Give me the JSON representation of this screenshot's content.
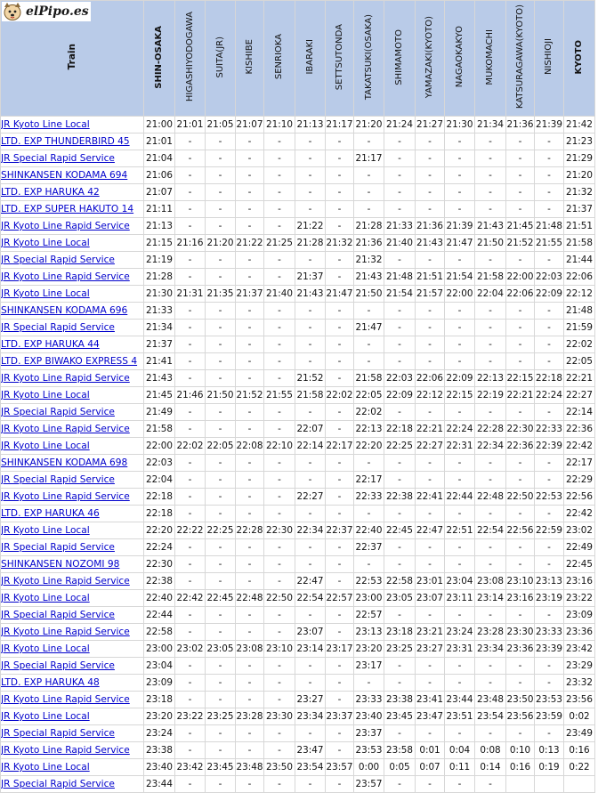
{
  "logo": {
    "text": "elPipo.es",
    "icon": "dog-face-icon"
  },
  "header": {
    "train_label": "Train",
    "stations": [
      "SHIN-OSAKA",
      "HIGASHIYODOGAWA",
      "SUITA(JR)",
      "KISHIBE",
      "SENRIOKA",
      "IBARAKI",
      "SETTSUTONDA",
      "TAKATSUKI(OSAKA)",
      "SHIMAMOTO",
      "YAMAZAKI(KYOTO)",
      "NAGAOKAKYO",
      "MUKOMACHI",
      "KATSURAGAWA(KYOTO)",
      "NISHIOJI",
      "KYOTO"
    ],
    "major_station_indices": [
      0,
      14
    ]
  },
  "rows": [
    {
      "train": "JR Kyoto Line Local",
      "times": [
        "21:00",
        "21:01",
        "21:05",
        "21:07",
        "21:10",
        "21:13",
        "21:17",
        "21:20",
        "21:24",
        "21:27",
        "21:30",
        "21:34",
        "21:36",
        "21:39",
        "21:42"
      ]
    },
    {
      "train": "LTD. EXP THUNDERBIRD 45",
      "times": [
        "21:01",
        "-",
        "-",
        "-",
        "-",
        "-",
        "-",
        "-",
        "-",
        "-",
        "-",
        "-",
        "-",
        "-",
        "21:23"
      ]
    },
    {
      "train": "JR Special Rapid Service",
      "times": [
        "21:04",
        "-",
        "-",
        "-",
        "-",
        "-",
        "-",
        "21:17",
        "-",
        "-",
        "-",
        "-",
        "-",
        "-",
        "21:29"
      ]
    },
    {
      "train": "SHINKANSEN KODAMA 694",
      "times": [
        "21:06",
        "-",
        "-",
        "-",
        "-",
        "-",
        "-",
        "-",
        "-",
        "-",
        "-",
        "-",
        "-",
        "-",
        "21:20"
      ]
    },
    {
      "train": "LTD. EXP HARUKA 42",
      "times": [
        "21:07",
        "-",
        "-",
        "-",
        "-",
        "-",
        "-",
        "-",
        "-",
        "-",
        "-",
        "-",
        "-",
        "-",
        "21:32"
      ]
    },
    {
      "train": "LTD. EXP SUPER HAKUTO 14",
      "times": [
        "21:11",
        "-",
        "-",
        "-",
        "-",
        "-",
        "-",
        "-",
        "-",
        "-",
        "-",
        "-",
        "-",
        "-",
        "21:37"
      ]
    },
    {
      "train": "JR Kyoto Line Rapid Service",
      "times": [
        "21:13",
        "-",
        "-",
        "-",
        "-",
        "21:22",
        "-",
        "21:28",
        "21:33",
        "21:36",
        "21:39",
        "21:43",
        "21:45",
        "21:48",
        "21:51"
      ]
    },
    {
      "train": "JR Kyoto Line Local",
      "times": [
        "21:15",
        "21:16",
        "21:20",
        "21:22",
        "21:25",
        "21:28",
        "21:32",
        "21:36",
        "21:40",
        "21:43",
        "21:47",
        "21:50",
        "21:52",
        "21:55",
        "21:58"
      ]
    },
    {
      "train": "JR Special Rapid Service",
      "times": [
        "21:19",
        "-",
        "-",
        "-",
        "-",
        "-",
        "-",
        "21:32",
        "-",
        "-",
        "-",
        "-",
        "-",
        "-",
        "21:44"
      ]
    },
    {
      "train": "JR Kyoto Line Rapid Service",
      "times": [
        "21:28",
        "-",
        "-",
        "-",
        "-",
        "21:37",
        "-",
        "21:43",
        "21:48",
        "21:51",
        "21:54",
        "21:58",
        "22:00",
        "22:03",
        "22:06"
      ]
    },
    {
      "train": "JR Kyoto Line Local",
      "times": [
        "21:30",
        "21:31",
        "21:35",
        "21:37",
        "21:40",
        "21:43",
        "21:47",
        "21:50",
        "21:54",
        "21:57",
        "22:00",
        "22:04",
        "22:06",
        "22:09",
        "22:12"
      ]
    },
    {
      "train": "SHINKANSEN KODAMA 696",
      "times": [
        "21:33",
        "-",
        "-",
        "-",
        "-",
        "-",
        "-",
        "-",
        "-",
        "-",
        "-",
        "-",
        "-",
        "-",
        "21:48"
      ]
    },
    {
      "train": "JR Special Rapid Service",
      "times": [
        "21:34",
        "-",
        "-",
        "-",
        "-",
        "-",
        "-",
        "21:47",
        "-",
        "-",
        "-",
        "-",
        "-",
        "-",
        "21:59"
      ]
    },
    {
      "train": "LTD. EXP HARUKA 44",
      "times": [
        "21:37",
        "-",
        "-",
        "-",
        "-",
        "-",
        "-",
        "-",
        "-",
        "-",
        "-",
        "-",
        "-",
        "-",
        "22:02"
      ]
    },
    {
      "train": "LTD. EXP BIWAKO EXPRESS 4",
      "times": [
        "21:41",
        "-",
        "-",
        "-",
        "-",
        "-",
        "-",
        "-",
        "-",
        "-",
        "-",
        "-",
        "-",
        "-",
        "22:05"
      ]
    },
    {
      "train": "JR Kyoto Line Rapid Service",
      "times": [
        "21:43",
        "-",
        "-",
        "-",
        "-",
        "21:52",
        "-",
        "21:58",
        "22:03",
        "22:06",
        "22:09",
        "22:13",
        "22:15",
        "22:18",
        "22:21"
      ]
    },
    {
      "train": "JR Kyoto Line Local",
      "times": [
        "21:45",
        "21:46",
        "21:50",
        "21:52",
        "21:55",
        "21:58",
        "22:02",
        "22:05",
        "22:09",
        "22:12",
        "22:15",
        "22:19",
        "22:21",
        "22:24",
        "22:27"
      ]
    },
    {
      "train": "JR Special Rapid Service",
      "times": [
        "21:49",
        "-",
        "-",
        "-",
        "-",
        "-",
        "-",
        "22:02",
        "-",
        "-",
        "-",
        "-",
        "-",
        "-",
        "22:14"
      ]
    },
    {
      "train": "JR Kyoto Line Rapid Service",
      "times": [
        "21:58",
        "-",
        "-",
        "-",
        "-",
        "22:07",
        "-",
        "22:13",
        "22:18",
        "22:21",
        "22:24",
        "22:28",
        "22:30",
        "22:33",
        "22:36"
      ]
    },
    {
      "train": "JR Kyoto Line Local",
      "times": [
        "22:00",
        "22:02",
        "22:05",
        "22:08",
        "22:10",
        "22:14",
        "22:17",
        "22:20",
        "22:25",
        "22:27",
        "22:31",
        "22:34",
        "22:36",
        "22:39",
        "22:42"
      ]
    },
    {
      "train": "SHINKANSEN KODAMA 698",
      "times": [
        "22:03",
        "-",
        "-",
        "-",
        "-",
        "-",
        "-",
        "-",
        "-",
        "-",
        "-",
        "-",
        "-",
        "-",
        "22:17"
      ]
    },
    {
      "train": "JR Special Rapid Service",
      "times": [
        "22:04",
        "-",
        "-",
        "-",
        "-",
        "-",
        "-",
        "22:17",
        "-",
        "-",
        "-",
        "-",
        "-",
        "-",
        "22:29"
      ]
    },
    {
      "train": "JR Kyoto Line Rapid Service",
      "times": [
        "22:18",
        "-",
        "-",
        "-",
        "-",
        "22:27",
        "-",
        "22:33",
        "22:38",
        "22:41",
        "22:44",
        "22:48",
        "22:50",
        "22:53",
        "22:56"
      ]
    },
    {
      "train": "LTD. EXP HARUKA 46",
      "times": [
        "22:18",
        "-",
        "-",
        "-",
        "-",
        "-",
        "-",
        "-",
        "-",
        "-",
        "-",
        "-",
        "-",
        "-",
        "22:42"
      ]
    },
    {
      "train": "JR Kyoto Line Local",
      "times": [
        "22:20",
        "22:22",
        "22:25",
        "22:28",
        "22:30",
        "22:34",
        "22:37",
        "22:40",
        "22:45",
        "22:47",
        "22:51",
        "22:54",
        "22:56",
        "22:59",
        "23:02"
      ]
    },
    {
      "train": "JR Special Rapid Service",
      "times": [
        "22:24",
        "-",
        "-",
        "-",
        "-",
        "-",
        "-",
        "22:37",
        "-",
        "-",
        "-",
        "-",
        "-",
        "-",
        "22:49"
      ]
    },
    {
      "train": "SHINKANSEN NOZOMI 98",
      "times": [
        "22:30",
        "-",
        "-",
        "-",
        "-",
        "-",
        "-",
        "-",
        "-",
        "-",
        "-",
        "-",
        "-",
        "-",
        "22:45"
      ]
    },
    {
      "train": "JR Kyoto Line Rapid Service",
      "times": [
        "22:38",
        "-",
        "-",
        "-",
        "-",
        "22:47",
        "-",
        "22:53",
        "22:58",
        "23:01",
        "23:04",
        "23:08",
        "23:10",
        "23:13",
        "23:16"
      ]
    },
    {
      "train": "JR Kyoto Line Local",
      "times": [
        "22:40",
        "22:42",
        "22:45",
        "22:48",
        "22:50",
        "22:54",
        "22:57",
        "23:00",
        "23:05",
        "23:07",
        "23:11",
        "23:14",
        "23:16",
        "23:19",
        "23:22"
      ]
    },
    {
      "train": "JR Special Rapid Service",
      "times": [
        "22:44",
        "-",
        "-",
        "-",
        "-",
        "-",
        "-",
        "22:57",
        "-",
        "-",
        "-",
        "-",
        "-",
        "-",
        "23:09"
      ]
    },
    {
      "train": "JR Kyoto Line Rapid Service",
      "times": [
        "22:58",
        "-",
        "-",
        "-",
        "-",
        "23:07",
        "-",
        "23:13",
        "23:18",
        "23:21",
        "23:24",
        "23:28",
        "23:30",
        "23:33",
        "23:36"
      ]
    },
    {
      "train": "JR Kyoto Line Local",
      "times": [
        "23:00",
        "23:02",
        "23:05",
        "23:08",
        "23:10",
        "23:14",
        "23:17",
        "23:20",
        "23:25",
        "23:27",
        "23:31",
        "23:34",
        "23:36",
        "23:39",
        "23:42"
      ]
    },
    {
      "train": "JR Special Rapid Service",
      "times": [
        "23:04",
        "-",
        "-",
        "-",
        "-",
        "-",
        "-",
        "23:17",
        "-",
        "-",
        "-",
        "-",
        "-",
        "-",
        "23:29"
      ]
    },
    {
      "train": "LTD. EXP HARUKA 48",
      "times": [
        "23:09",
        "-",
        "-",
        "-",
        "-",
        "-",
        "-",
        "-",
        "-",
        "-",
        "-",
        "-",
        "-",
        "-",
        "23:32"
      ]
    },
    {
      "train": "JR Kyoto Line Rapid Service",
      "times": [
        "23:18",
        "-",
        "-",
        "-",
        "-",
        "23:27",
        "-",
        "23:33",
        "23:38",
        "23:41",
        "23:44",
        "23:48",
        "23:50",
        "23:53",
        "23:56"
      ]
    },
    {
      "train": "JR Kyoto Line Local",
      "times": [
        "23:20",
        "23:22",
        "23:25",
        "23:28",
        "23:30",
        "23:34",
        "23:37",
        "23:40",
        "23:45",
        "23:47",
        "23:51",
        "23:54",
        "23:56",
        "23:59",
        "0:02"
      ]
    },
    {
      "train": "JR Special Rapid Service",
      "times": [
        "23:24",
        "-",
        "-",
        "-",
        "-",
        "-",
        "-",
        "23:37",
        "-",
        "-",
        "-",
        "-",
        "-",
        "-",
        "23:49"
      ]
    },
    {
      "train": "JR Kyoto Line Rapid Service",
      "times": [
        "23:38",
        "-",
        "-",
        "-",
        "-",
        "23:47",
        "-",
        "23:53",
        "23:58",
        "0:01",
        "0:04",
        "0:08",
        "0:10",
        "0:13",
        "0:16"
      ]
    },
    {
      "train": "JR Kyoto Line Local",
      "times": [
        "23:40",
        "23:42",
        "23:45",
        "23:48",
        "23:50",
        "23:54",
        "23:57",
        "0:00",
        "0:05",
        "0:07",
        "0:11",
        "0:14",
        "0:16",
        "0:19",
        "0:22"
      ]
    },
    {
      "train": "JR Special Rapid Service",
      "times": [
        "23:44",
        "-",
        "-",
        "-",
        "-",
        "-",
        "-",
        "23:57",
        "-",
        "-",
        "-",
        "-",
        "",
        "",
        ""
      ]
    }
  ]
}
